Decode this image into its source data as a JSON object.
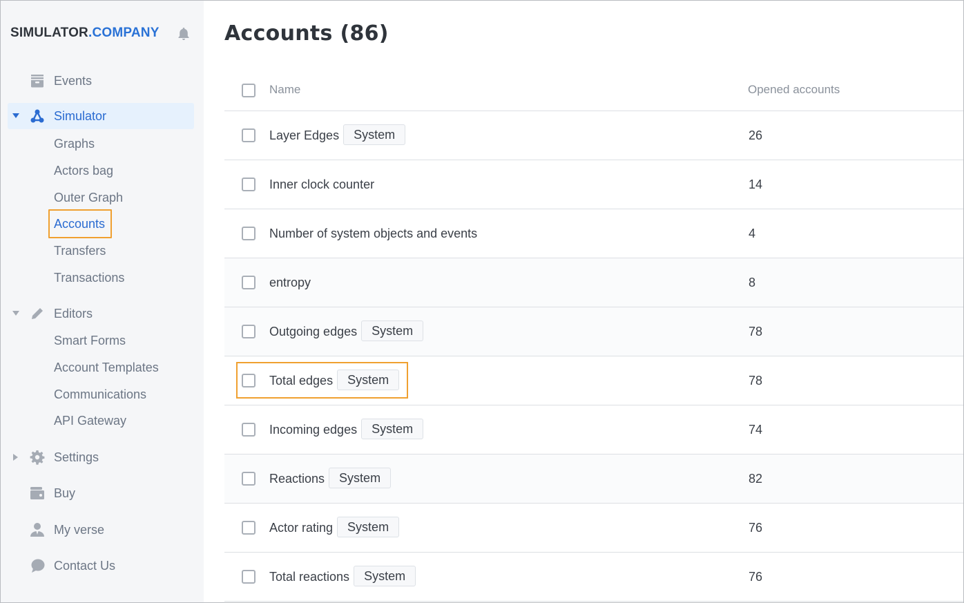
{
  "brand": {
    "part1": "SIMULATOR",
    "part2": ".COMPANY"
  },
  "colors": {
    "accent": "#2a72d6",
    "highlight": "#f0a030",
    "sidebar_bg": "#f5f6f8",
    "active_bg": "#e6f1fd"
  },
  "sidebar": {
    "events": {
      "label": "Events",
      "icon": "archive-icon"
    },
    "simulator": {
      "label": "Simulator",
      "icon": "graph-nodes-icon",
      "expanded": true,
      "children": [
        "Graphs",
        "Actors bag",
        "Outer Graph",
        "Accounts",
        "Transfers",
        "Transactions"
      ],
      "selected": "Accounts"
    },
    "editors": {
      "label": "Editors",
      "icon": "pencil-icon",
      "expanded": true,
      "children": [
        "Smart Forms",
        "Account Templates",
        "Communications",
        "API Gateway"
      ]
    },
    "settings": {
      "label": "Settings",
      "icon": "gear-icon",
      "expanded": false
    },
    "buy": {
      "label": "Buy",
      "icon": "wallet-icon"
    },
    "my_verse": {
      "label": "My verse",
      "icon": "user-icon"
    },
    "contact_us": {
      "label": "Contact Us",
      "icon": "chat-bubble-icon"
    }
  },
  "main": {
    "title": "Accounts (86)",
    "table": {
      "columns": [
        "Name",
        "Opened accounts"
      ],
      "rows": [
        {
          "name": "Layer Edges",
          "badge": "System",
          "opened": "26"
        },
        {
          "name": "Inner clock counter",
          "badge": null,
          "opened": "14"
        },
        {
          "name": "Number of system objects and events",
          "badge": null,
          "opened": "4"
        },
        {
          "name": "entropy",
          "badge": null,
          "opened": "8"
        },
        {
          "name": "Outgoing edges",
          "badge": "System",
          "opened": "78"
        },
        {
          "name": "Total edges",
          "badge": "System",
          "opened": "78",
          "highlighted": true
        },
        {
          "name": "Incoming edges",
          "badge": "System",
          "opened": "74"
        },
        {
          "name": "Reactions",
          "badge": "System",
          "opened": "82"
        },
        {
          "name": "Actor rating",
          "badge": "System",
          "opened": "76"
        },
        {
          "name": "Total reactions",
          "badge": "System",
          "opened": "76"
        }
      ]
    }
  }
}
